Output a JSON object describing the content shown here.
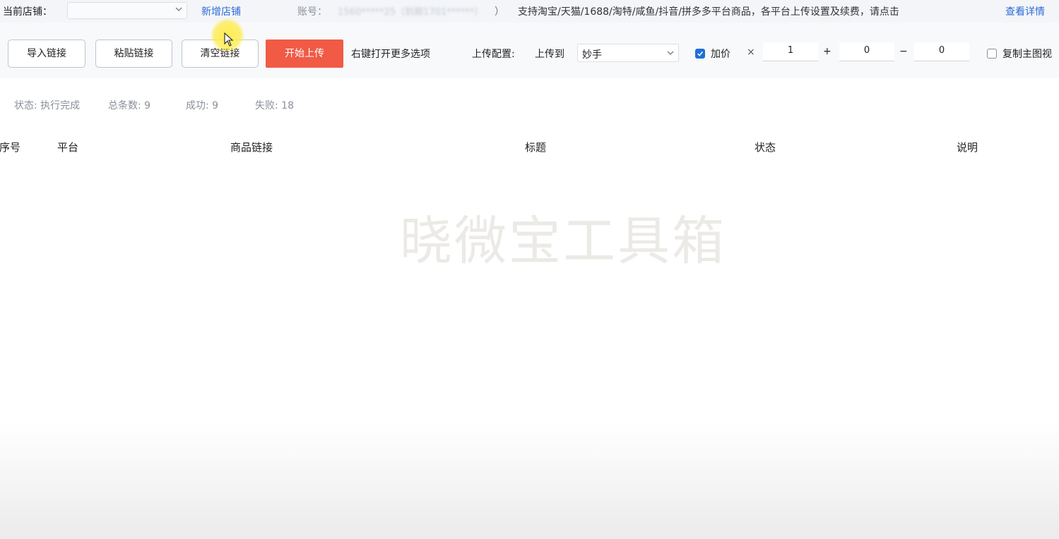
{
  "topbar": {
    "store_label": "当前店铺：",
    "store_value": "",
    "add_store": "新增店铺",
    "account_label": "账号：",
    "account_value": "1560*****25（到期1701******）",
    "account_paren": "）",
    "notice": "支持淘宝/天猫/1688/淘特/咸鱼/抖音/拼多多平台商品，各平台上传设置及续费，请点击",
    "notice_link": "查看详情"
  },
  "toolbar": {
    "import_label": "导入链接",
    "paste_label": "粘贴链接",
    "clear_label": "清空链接",
    "start_label": "开始上传",
    "more_options": "右键打开更多选项",
    "upload_config": "上传配置:",
    "upload_to": "上传到",
    "upload_target": "妙手",
    "markup_checked": true,
    "markup_label": "加价",
    "times_symbol": "×",
    "multiplier": "1",
    "plus_symbol": "+",
    "add_value": "0",
    "minus_symbol": "−",
    "subtract_value": "0",
    "copy_main_image_checked": false,
    "copy_main_image_label": "复制主图视"
  },
  "status": {
    "state": "状态: 执行完成",
    "total": "总条数: 9",
    "success": "成功: 9",
    "fail": "失败: 18"
  },
  "table": {
    "columns": [
      "序号",
      "平台",
      "商品链接",
      "标题",
      "状态",
      "说明"
    ],
    "rows": []
  },
  "watermark": "晓微宝工具箱",
  "colors": {
    "accent": "#1f6fd9",
    "link": "#2d6bd6",
    "start_button": "#f15a45"
  }
}
